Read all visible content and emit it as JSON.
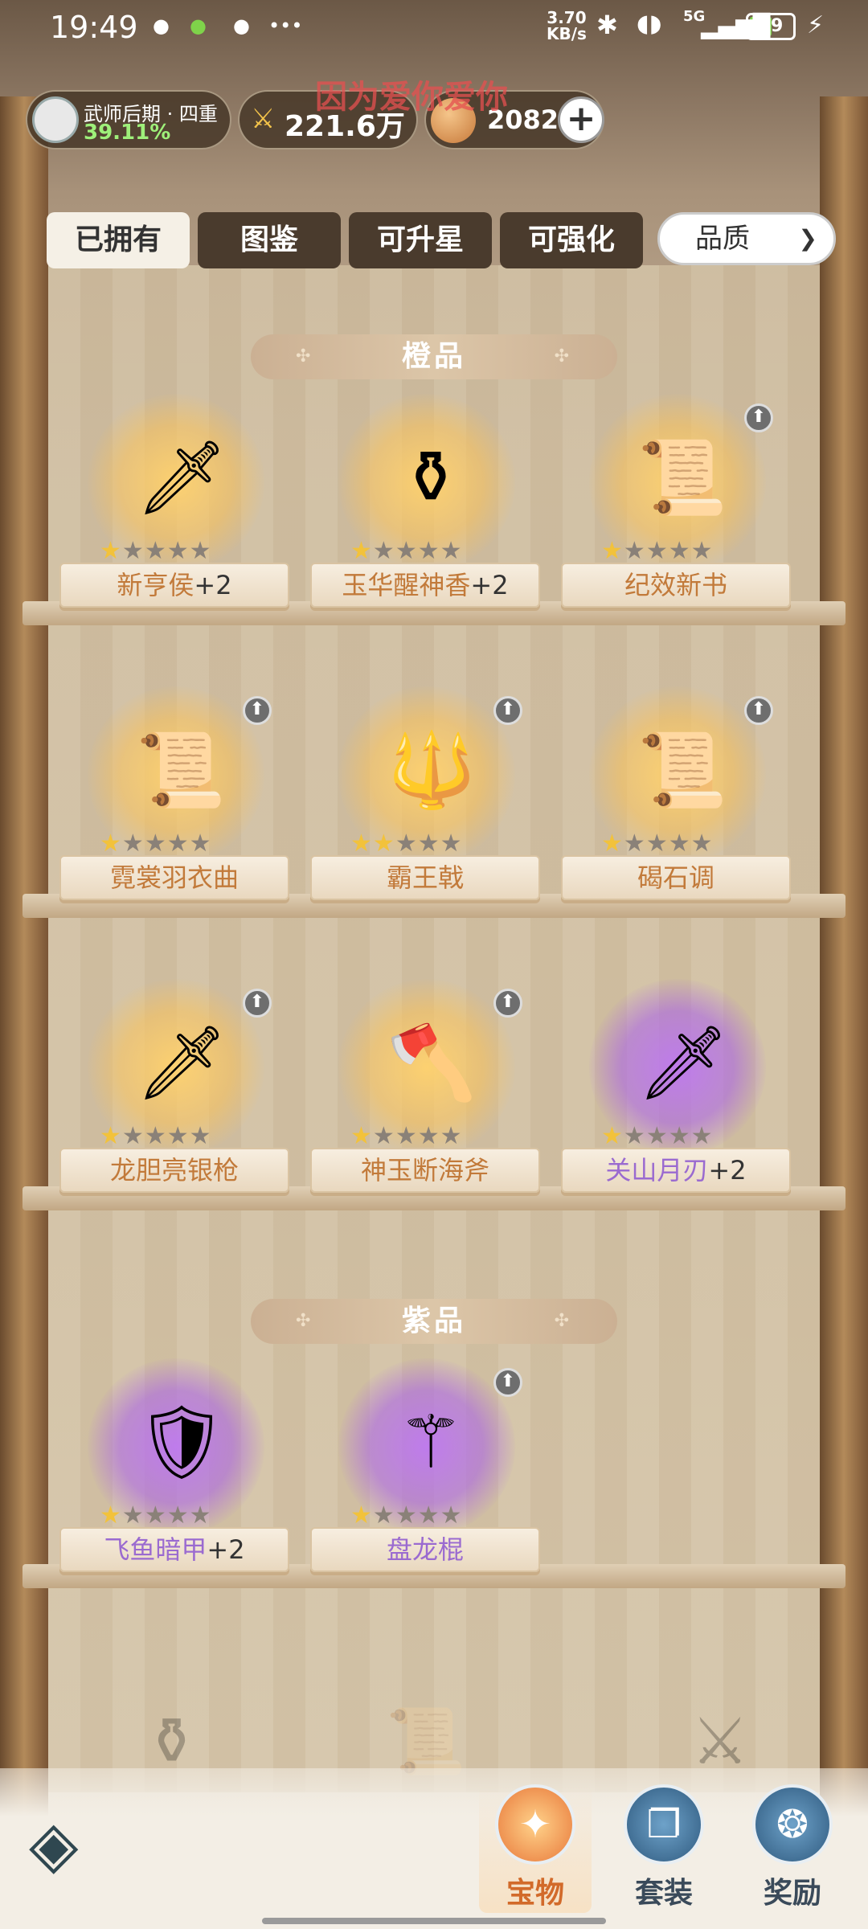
{
  "status": {
    "time": "19:49",
    "speed_top": "3.70",
    "speed_bottom": "KB/s",
    "network": "5G",
    "battery": "49"
  },
  "header": {
    "rank_title": "武师后期 · 四重",
    "rank_progress": "39.11%",
    "power": "221.6万",
    "coins": "2082",
    "overlay_text": "因为爱你爱你"
  },
  "tabs": [
    {
      "label": "已拥有"
    },
    {
      "label": "图鉴"
    },
    {
      "label": "可升星"
    },
    {
      "label": "可强化"
    }
  ],
  "filter": {
    "label": "品质"
  },
  "sections": {
    "orange": "橙品",
    "purple": "紫品"
  },
  "items": [
    {
      "name": "新亨侯",
      "plus": "+2",
      "stars": 1,
      "icon": "sword-icon",
      "upgrade": false
    },
    {
      "name": "玉华醒神香",
      "plus": "+2",
      "stars": 1,
      "icon": "vase-icon",
      "upgrade": false
    },
    {
      "name": "纪效新书",
      "plus": "",
      "stars": 1,
      "icon": "scroll-icon",
      "upgrade": true
    },
    {
      "name": "霓裳羽衣曲",
      "plus": "",
      "stars": 1,
      "icon": "painting-scroll-icon",
      "upgrade": true
    },
    {
      "name": "霸王戟",
      "plus": "",
      "stars": 2,
      "icon": "halberd-icon",
      "upgrade": true
    },
    {
      "name": "碣石调",
      "plus": "",
      "stars": 1,
      "icon": "wave-scroll-icon",
      "upgrade": true
    },
    {
      "name": "龙胆亮银枪",
      "plus": "",
      "stars": 1,
      "icon": "spear-icon",
      "upgrade": true
    },
    {
      "name": "神玉断海斧",
      "plus": "",
      "stars": 1,
      "icon": "axe-icon",
      "upgrade": true
    },
    {
      "name": "关山月刃",
      "plus": "+2",
      "stars": 1,
      "icon": "blade-icon",
      "upgrade": false
    },
    {
      "name": "飞鱼暗甲",
      "plus": "+2",
      "stars": 1,
      "icon": "armor-icon",
      "upgrade": false
    },
    {
      "name": "盘龙棍",
      "plus": "",
      "stars": 1,
      "icon": "staff-icon",
      "upgrade": true
    }
  ],
  "nav": [
    {
      "label": "宝物"
    },
    {
      "label": "套装"
    },
    {
      "label": "奖励"
    }
  ]
}
